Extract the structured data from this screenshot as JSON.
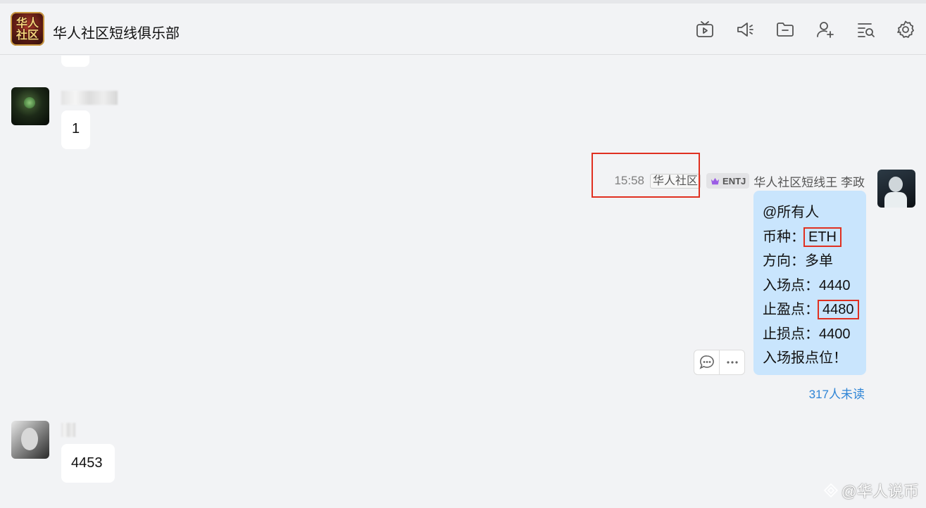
{
  "header": {
    "group_avatar_text": [
      "华人",
      "社区"
    ],
    "title": "华人社区短线俱乐部",
    "toolbar": [
      {
        "name": "live-icon"
      },
      {
        "name": "announcement-icon"
      },
      {
        "name": "folder-icon"
      },
      {
        "name": "add-member-icon"
      },
      {
        "name": "search-history-icon"
      },
      {
        "name": "settings-icon"
      }
    ]
  },
  "messages": {
    "m1": {
      "text": "1"
    },
    "m2": {
      "time": "15:58",
      "tag": "华人社区",
      "badge": "ENTJ",
      "sender": "华人社区短线王 李政",
      "lines": {
        "l1": "@所有人",
        "l2_label": "币种：",
        "l2_value": "ETH",
        "l3": "方向：多单",
        "l4": "入场点：4440",
        "l5_label": "止盈点：",
        "l5_value": "4480",
        "l6": "止损点：4400",
        "l7": "入场报点位！"
      },
      "unread": "317人未读"
    },
    "m3": {
      "text": "4453"
    }
  },
  "watermark": "@华人说币",
  "colors": {
    "bubble_self": "#c9e5fd",
    "highlight": "#e03020",
    "link": "#2f85d6"
  }
}
